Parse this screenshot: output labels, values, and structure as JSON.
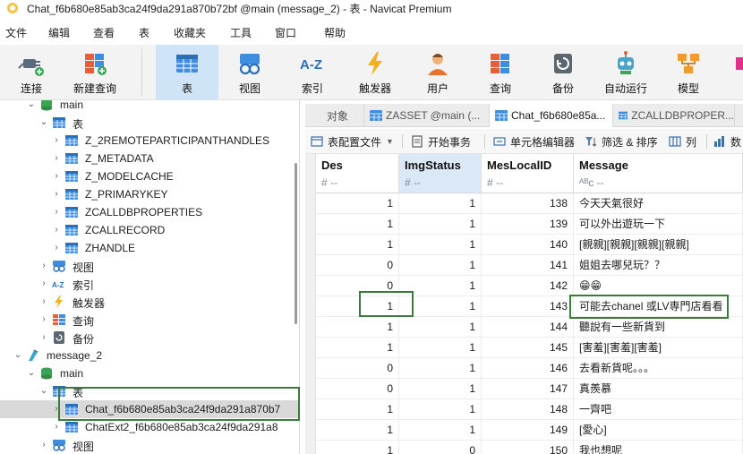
{
  "window": {
    "title": "Chat_f6b680e85ab3ca24f9da291a870b72bf @main (message_2) - 表 - Navicat Premium"
  },
  "menu": [
    "文件",
    "编辑",
    "查看",
    "表",
    "收藏夹",
    "工具",
    "窗口",
    "帮助"
  ],
  "toolbar": [
    {
      "label": "连接",
      "icon": "connection-icon"
    },
    {
      "label": "新建查询",
      "icon": "new-query-icon"
    },
    {
      "label": "表",
      "icon": "table-icon",
      "active": true
    },
    {
      "label": "视图",
      "icon": "view-icon"
    },
    {
      "label": "索引",
      "icon": "index-icon"
    },
    {
      "label": "触发器",
      "icon": "trigger-icon"
    },
    {
      "label": "用户",
      "icon": "user-icon"
    },
    {
      "label": "查询",
      "icon": "query-icon"
    },
    {
      "label": "备份",
      "icon": "backup-icon"
    },
    {
      "label": "自动运行",
      "icon": "automation-icon"
    },
    {
      "label": "模型",
      "icon": "model-icon"
    }
  ],
  "navigator": {
    "rows": [
      {
        "label": "main",
        "icon": "database-icon",
        "level": 1,
        "chevron": "open"
      },
      {
        "label": "表",
        "icon": "table-icon",
        "level": 2,
        "chevron": "open"
      },
      {
        "label": "Z_2REMOTEPARTICIPANTHANDLES",
        "icon": "table-icon",
        "level": 3,
        "chevron": "closed"
      },
      {
        "label": "Z_METADATA",
        "icon": "table-icon",
        "level": 3,
        "chevron": "closed"
      },
      {
        "label": "Z_MODELCACHE",
        "icon": "table-icon",
        "level": 3,
        "chevron": "closed"
      },
      {
        "label": "Z_PRIMARYKEY",
        "icon": "table-icon",
        "level": 3,
        "chevron": "closed"
      },
      {
        "label": "ZCALLDBPROPERTIES",
        "icon": "table-icon",
        "level": 3,
        "chevron": "closed"
      },
      {
        "label": "ZCALLRECORD",
        "icon": "table-icon",
        "level": 3,
        "chevron": "closed"
      },
      {
        "label": "ZHANDLE",
        "icon": "table-icon",
        "level": 3,
        "chevron": "closed"
      },
      {
        "label": "视图",
        "icon": "view-icon",
        "level": 2,
        "chevron": "closed"
      },
      {
        "label": "索引",
        "icon": "index-icon",
        "level": 2,
        "chevron": "closed"
      },
      {
        "label": "触发器",
        "icon": "trigger-icon",
        "level": 2,
        "chevron": "closed"
      },
      {
        "label": "查询",
        "icon": "query-icon",
        "level": 2,
        "chevron": "closed"
      },
      {
        "label": "备份",
        "icon": "backup-icon",
        "level": 2,
        "chevron": "closed"
      },
      {
        "label": "message_2",
        "icon": "sqlite-connection-icon",
        "level": 0,
        "chevron": "open"
      },
      {
        "label": "main",
        "icon": "database-icon",
        "level": 1,
        "chevron": "open"
      },
      {
        "label": "表",
        "icon": "table-icon",
        "level": 2,
        "chevron": "open"
      },
      {
        "label": "Chat_f6b680e85ab3ca24f9da291a870b7",
        "icon": "table-icon",
        "level": 3,
        "chevron": "closed",
        "selected": true
      },
      {
        "label": "ChatExt2_f6b680e85ab3ca24f9da291a8",
        "icon": "table-icon",
        "level": 3,
        "chevron": "closed"
      },
      {
        "label": "视图",
        "icon": "view-icon",
        "level": 2,
        "chevron": "closed"
      }
    ]
  },
  "tabs": [
    {
      "label": "对象",
      "active": false
    },
    {
      "label": "ZASSET @main (...",
      "active": false
    },
    {
      "label": "Chat_f6b680e85a...",
      "active": true
    },
    {
      "label": "ZCALLDBPROPER...",
      "active": false
    },
    {
      "label": "",
      "active": false
    }
  ],
  "table_toolbar": [
    {
      "label": "表配置文件",
      "icon": "table-profile-icon",
      "dropdown": true
    },
    {
      "label": "开始事务",
      "icon": "begin-transaction-icon"
    },
    {
      "label": "单元格编辑器",
      "icon": "cell-editor-icon"
    },
    {
      "label": "筛选 & 排序",
      "icon": "filter-sort-icon"
    },
    {
      "label": "列",
      "icon": "columns-icon"
    },
    {
      "label": "数",
      "icon": "data-icon"
    }
  ],
  "grid": {
    "columns": [
      {
        "name": "Des",
        "type": "# --"
      },
      {
        "name": "ImgStatus",
        "type": "# --"
      },
      {
        "name": "MesLocalID",
        "type": "# --"
      },
      {
        "name": "Message",
        "type": "ᴬᴮc --"
      }
    ],
    "rows": [
      [
        "1",
        "1",
        "138",
        "今天天氣很好"
      ],
      [
        "1",
        "1",
        "139",
        "可以外出遊玩一下"
      ],
      [
        "1",
        "1",
        "140",
        "[親親][親親][親親][親親]"
      ],
      [
        "0",
        "1",
        "141",
        "姐姐去哪兒玩？？"
      ],
      [
        "0",
        "1",
        "142",
        "😁😁"
      ],
      [
        "1",
        "1",
        "143",
        "可能去chanel 或LV専門店看看"
      ],
      [
        "1",
        "1",
        "144",
        "聽說有一些新貨到"
      ],
      [
        "1",
        "1",
        "145",
        "[害羞][害羞][害羞]"
      ],
      [
        "0",
        "1",
        "146",
        "去看新貨呢。。。"
      ],
      [
        "0",
        "1",
        "147",
        "真羨慕"
      ],
      [
        "1",
        "1",
        "148",
        "一齊吧"
      ],
      [
        "1",
        "1",
        "149",
        "[愛心]"
      ],
      [
        "1",
        "0",
        "150",
        "我也想呢"
      ]
    ]
  },
  "colors": {
    "highlight_box": "#3a7d3a",
    "active_tool_bg": "#cfe4f7",
    "selected_col_bg": "#dbe8f6"
  }
}
